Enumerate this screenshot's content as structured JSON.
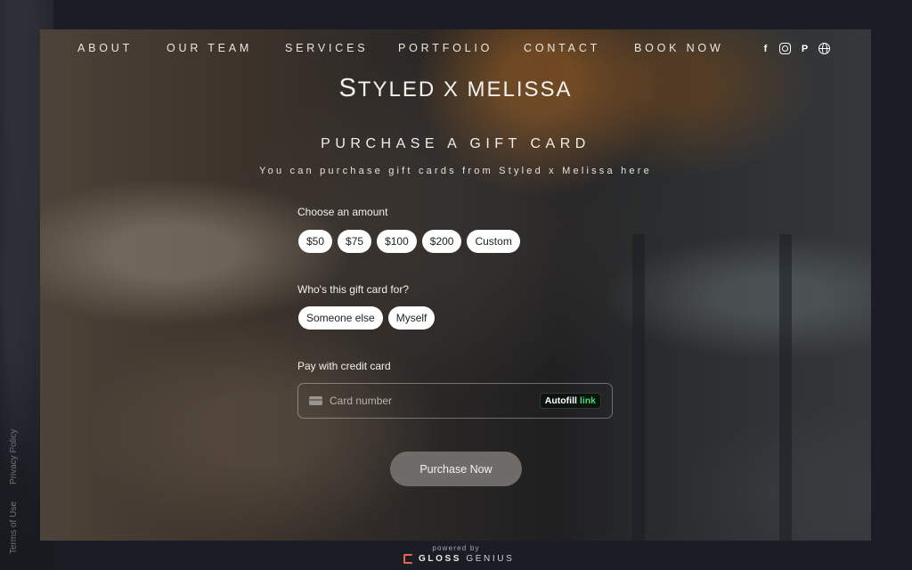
{
  "nav": {
    "items": [
      {
        "label": "ABOUT"
      },
      {
        "label": "OUR TEAM"
      },
      {
        "label": "SERVICES"
      },
      {
        "label": "PORTFOLIO"
      },
      {
        "label": "CONTACT"
      },
      {
        "label": "BOOK NOW"
      }
    ],
    "social": [
      "facebook-icon",
      "instagram-icon",
      "pinterest-icon",
      "globe-icon"
    ]
  },
  "brand": {
    "first_initial": "S",
    "rest": "TYLED X MELISSA"
  },
  "page": {
    "title": "PURCHASE A GIFT CARD",
    "subtitle": "You can purchase gift cards from Styled x Melissa here"
  },
  "amount": {
    "label": "Choose an amount",
    "options": [
      "$50",
      "$75",
      "$100",
      "$200",
      "Custom"
    ]
  },
  "recipient": {
    "label": "Who's this gift card for?",
    "options": [
      "Someone else",
      "Myself"
    ]
  },
  "payment": {
    "label": "Pay with credit card",
    "placeholder": "Card number",
    "autofill": "Autofill",
    "autofill_brand": "link"
  },
  "purchase_button": "Purchase Now",
  "footer": {
    "terms": "Terms of Use",
    "privacy": "Privacy Policy",
    "powered_by": "powered by",
    "brand_bold": "GLOSS",
    "brand_light": "GENIUS"
  }
}
